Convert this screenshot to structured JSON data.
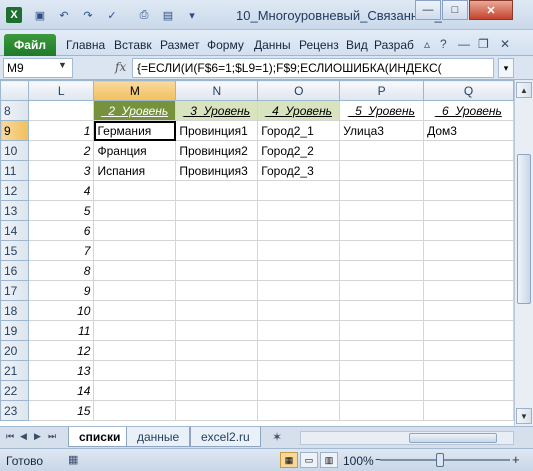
{
  "window": {
    "title": "10_Многоуровневый_Связанный_",
    "qat_icons": [
      "excel-logo-icon",
      "save-icon",
      "undo-icon",
      "redo-icon",
      "spellcheck-icon",
      "print-icon",
      "open-icon",
      "customize-arrow-icon"
    ],
    "controls": {
      "minimize": "—",
      "maximize": "□",
      "close": "✕"
    }
  },
  "ribbon": {
    "file_tab": "Файл",
    "tabs": [
      "Главна",
      "Вставк",
      "Размет",
      "Форму",
      "Данны",
      "Реценз",
      "Вид",
      "Разраб"
    ]
  },
  "formula_bar": {
    "name_box": "M9",
    "fx": "fx",
    "formula": "{=ЕСЛИ(И(F$6=1;$L9=1);F$9;ЕСЛИОШИБКА(ИНДЕКС("
  },
  "grid": {
    "columns": [
      "L",
      "M",
      "N",
      "O",
      "P",
      "Q"
    ],
    "selected_column": "M",
    "selected_row": "9",
    "rows": [
      {
        "row": "8",
        "cells": [
          "",
          "_2_Уровень",
          "_3_Уровень",
          "_4_Уровень",
          "_5_Уровень",
          "_6_Уровень"
        ]
      },
      {
        "row": "9",
        "cells": [
          "1",
          "Германия",
          "Провинция1",
          "Город2_1",
          "Улица3",
          "Дом3"
        ]
      },
      {
        "row": "10",
        "cells": [
          "2",
          "Франция",
          "Провинция2",
          "Город2_2",
          "",
          ""
        ]
      },
      {
        "row": "11",
        "cells": [
          "3",
          "Испания",
          "Провинция3",
          "Город2_3",
          "",
          ""
        ]
      },
      {
        "row": "12",
        "cells": [
          "4",
          "",
          "",
          "",
          "",
          ""
        ]
      },
      {
        "row": "13",
        "cells": [
          "5",
          "",
          "",
          "",
          "",
          ""
        ]
      },
      {
        "row": "14",
        "cells": [
          "6",
          "",
          "",
          "",
          "",
          ""
        ]
      },
      {
        "row": "15",
        "cells": [
          "7",
          "",
          "",
          "",
          "",
          ""
        ]
      },
      {
        "row": "16",
        "cells": [
          "8",
          "",
          "",
          "",
          "",
          ""
        ]
      },
      {
        "row": "17",
        "cells": [
          "9",
          "",
          "",
          "",
          "",
          ""
        ]
      },
      {
        "row": "18",
        "cells": [
          "10",
          "",
          "",
          "",
          "",
          ""
        ]
      },
      {
        "row": "19",
        "cells": [
          "11",
          "",
          "",
          "",
          "",
          ""
        ]
      },
      {
        "row": "20",
        "cells": [
          "12",
          "",
          "",
          "",
          "",
          ""
        ]
      },
      {
        "row": "21",
        "cells": [
          "13",
          "",
          "",
          "",
          "",
          ""
        ]
      },
      {
        "row": "22",
        "cells": [
          "14",
          "",
          "",
          "",
          "",
          ""
        ]
      },
      {
        "row": "23",
        "cells": [
          "15",
          "",
          "",
          "",
          "",
          ""
        ]
      }
    ],
    "header_colors": {
      "dark_green": "#76923c",
      "light_green": "#d7e4bd"
    }
  },
  "sheets": {
    "tabs": [
      "списки",
      "данные",
      "excel2.ru"
    ],
    "active": "списки"
  },
  "status_bar": {
    "status": "Готово",
    "zoom": "100%",
    "zoom_minus": "−",
    "zoom_plus": "+"
  }
}
